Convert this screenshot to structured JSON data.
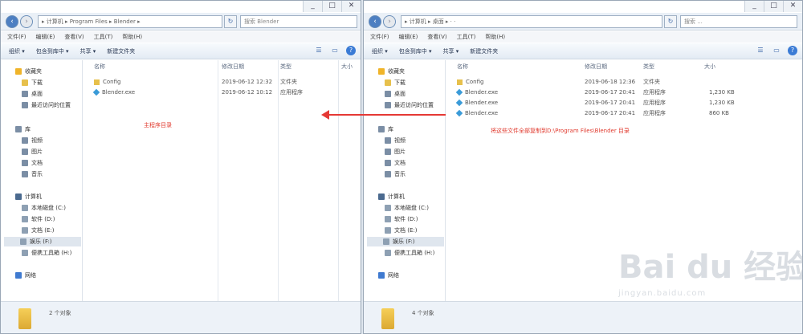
{
  "left": {
    "caption": {
      "min": "_",
      "max": "□",
      "close": "✕"
    },
    "address": "▸ 计算机 ▸ Program Files ▸ Blender ▸",
    "search_placeholder": "搜索 Blender",
    "menu": [
      "文件(F)",
      "编辑(E)",
      "查看(V)",
      "工具(T)",
      "帮助(H)"
    ],
    "toolbar": [
      "组织 ▾",
      "包含到库中 ▾",
      "共享 ▾",
      "新建文件夹"
    ],
    "sidebar": [
      {
        "label": "收藏夹",
        "icon": "star-icon"
      },
      {
        "label": "下载",
        "icon": "download-folder-icon"
      },
      {
        "label": "桌面",
        "icon": "desktop-icon"
      },
      {
        "label": "最近访问的位置",
        "icon": "recent-places-icon"
      },
      {
        "label": "库",
        "icon": "library-icon"
      },
      {
        "label": "视频",
        "icon": "video-icon"
      },
      {
        "label": "图片",
        "icon": "picture-icon"
      },
      {
        "label": "文档",
        "icon": "document-icon"
      },
      {
        "label": "音乐",
        "icon": "music-icon"
      },
      {
        "label": "计算机",
        "icon": "computer-icon"
      },
      {
        "label": "本地磁盘 (C:)",
        "icon": "drive-icon"
      },
      {
        "label": "软件 (D:)",
        "icon": "drive-icon"
      },
      {
        "label": "文档 (E:)",
        "icon": "drive-icon"
      },
      {
        "label": "娱乐 (F:)",
        "icon": "drive-icon"
      },
      {
        "label": "便携工具箱 (H:)",
        "icon": "drive-icon"
      },
      {
        "label": "网络",
        "icon": "network-icon"
      }
    ],
    "columns": [
      "名称",
      "修改日期",
      "类型",
      "大小"
    ],
    "files": [
      {
        "name": "Config",
        "date": "2019-06-12 12:32",
        "type": "文件夹",
        "size": "",
        "icon": "folder-icon"
      },
      {
        "name": "Blender.exe",
        "date": "2019-06-12 10:12",
        "type": "应用程序",
        "size": "",
        "icon": "exe-icon"
      }
    ],
    "status": "2 个对象",
    "note": "主程序目录"
  },
  "right": {
    "caption": {
      "min": "_",
      "max": "□",
      "close": "✕"
    },
    "address": "▸ 计算机 ▸ 桌面 ▸ · ·",
    "search_placeholder": "搜索 ...",
    "menu": [
      "文件(F)",
      "编辑(E)",
      "查看(V)",
      "工具(T)",
      "帮助(H)"
    ],
    "toolbar": [
      "组织 ▾",
      "包含到库中 ▾",
      "共享 ▾",
      "新建文件夹"
    ],
    "sidebar": [
      {
        "label": "收藏夹",
        "icon": "star-icon"
      },
      {
        "label": "下载",
        "icon": "download-folder-icon"
      },
      {
        "label": "桌面",
        "icon": "desktop-icon"
      },
      {
        "label": "最近访问的位置",
        "icon": "recent-places-icon"
      },
      {
        "label": "库",
        "icon": "library-icon"
      },
      {
        "label": "视频",
        "icon": "video-icon"
      },
      {
        "label": "图片",
        "icon": "picture-icon"
      },
      {
        "label": "文档",
        "icon": "document-icon"
      },
      {
        "label": "音乐",
        "icon": "music-icon"
      },
      {
        "label": "计算机",
        "icon": "computer-icon"
      },
      {
        "label": "本地磁盘 (C:)",
        "icon": "drive-icon"
      },
      {
        "label": "软件 (D:)",
        "icon": "drive-icon"
      },
      {
        "label": "文档 (E:)",
        "icon": "drive-icon"
      },
      {
        "label": "娱乐 (F:)",
        "icon": "drive-icon"
      },
      {
        "label": "便携工具箱 (H:)",
        "icon": "drive-icon"
      },
      {
        "label": "网络",
        "icon": "network-icon"
      }
    ],
    "columns": [
      "名称",
      "修改日期",
      "类型",
      "大小"
    ],
    "files": [
      {
        "name": "Config",
        "date": "2019-06-18 12:36",
        "type": "文件夹",
        "size": "",
        "icon": "folder-icon"
      },
      {
        "name": "Blender.exe",
        "date": "2019-06-17 20:41",
        "type": "应用程序",
        "size": "1,230 KB",
        "icon": "exe-icon"
      },
      {
        "name": "Blender.exe",
        "date": "2019-06-17 20:41",
        "type": "应用程序",
        "size": "1,230 KB",
        "icon": "exe-icon"
      },
      {
        "name": "Blender.exe",
        "date": "2019-06-17 20:41",
        "type": "应用程序",
        "size": "860 KB",
        "icon": "exe-icon"
      }
    ],
    "status": "4 个对象",
    "note": "将这些文件全部复制到D:\\Program Files\\Blender 目录"
  },
  "watermark": {
    "main": "Bai du 经验",
    "sub": "jingyan.baidu.com"
  },
  "colors": {
    "arrow": "#e53935",
    "note": "#e03a2e",
    "selection": "#dfe6ee"
  }
}
